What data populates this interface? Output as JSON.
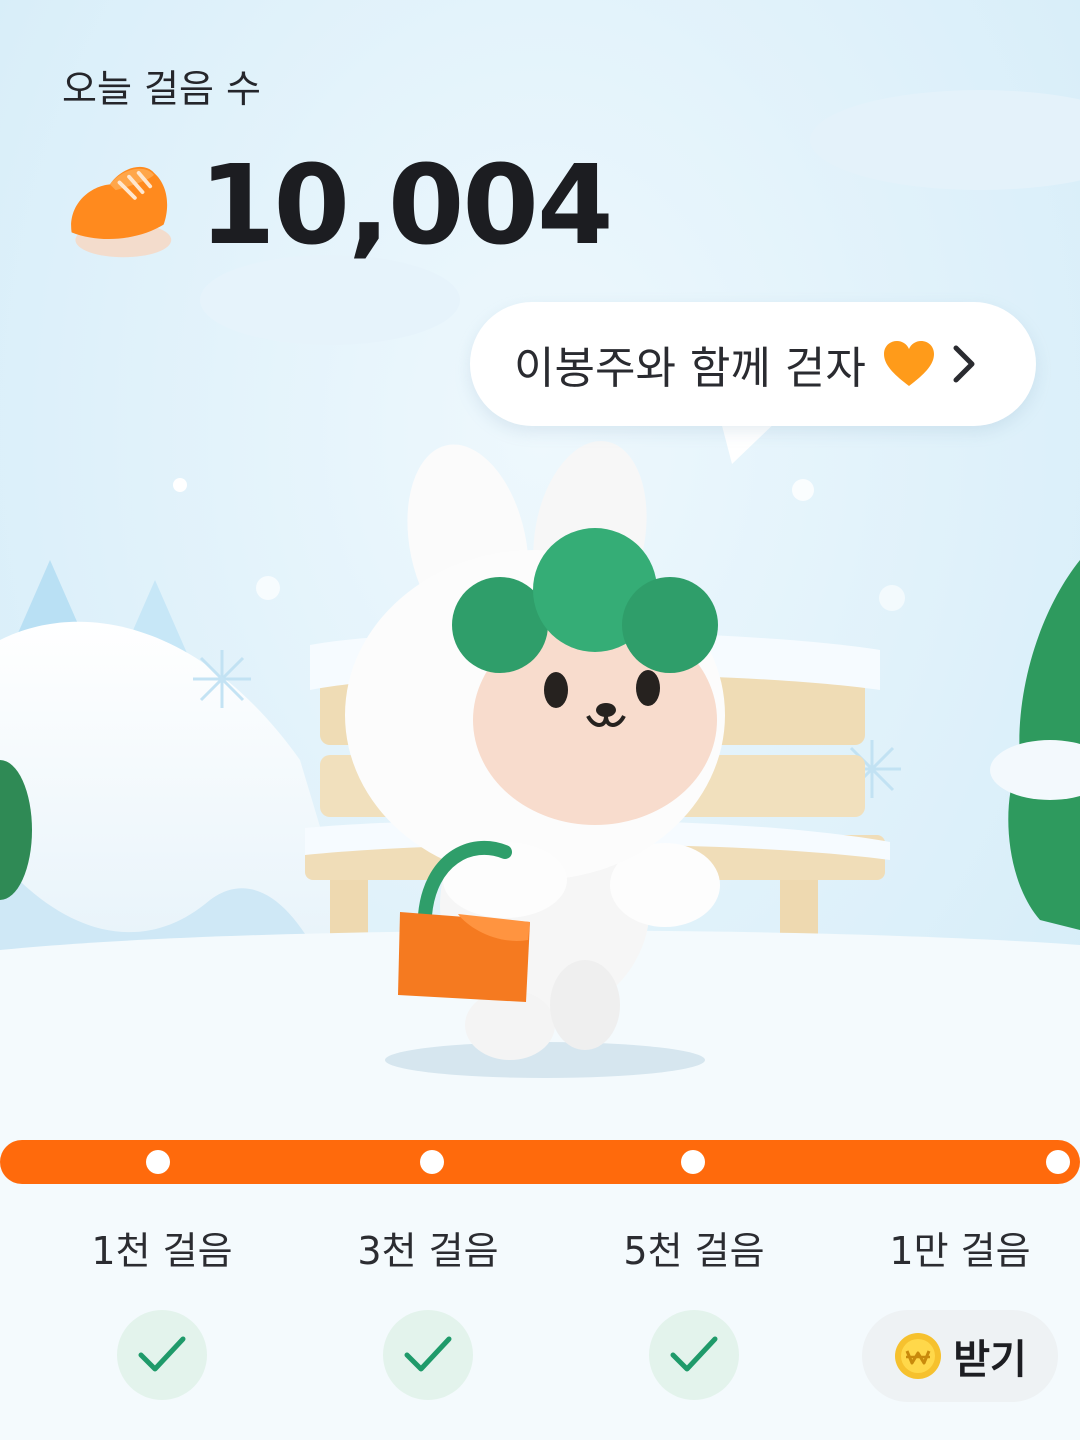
{
  "header": {
    "title": "오늘 걸음 수",
    "steps": "10,004"
  },
  "bubble": {
    "text": "이봉주와 함께 걷자"
  },
  "milestones": [
    {
      "label": "1천 걸음",
      "status": "done"
    },
    {
      "label": "3천 걸음",
      "status": "done"
    },
    {
      "label": "5천 걸음",
      "status": "done"
    },
    {
      "label": "1만 걸음",
      "status": "claimable"
    }
  ],
  "claim": {
    "label": "받기"
  },
  "colors": {
    "accent": "#ff6a0c",
    "check": "#1f9a6a",
    "check_bg": "#e3f3ec",
    "heart": "#ff9b1a"
  },
  "icons": [
    "shoe-icon",
    "heart-icon",
    "chevron-right-icon",
    "check-icon",
    "coin-icon"
  ]
}
